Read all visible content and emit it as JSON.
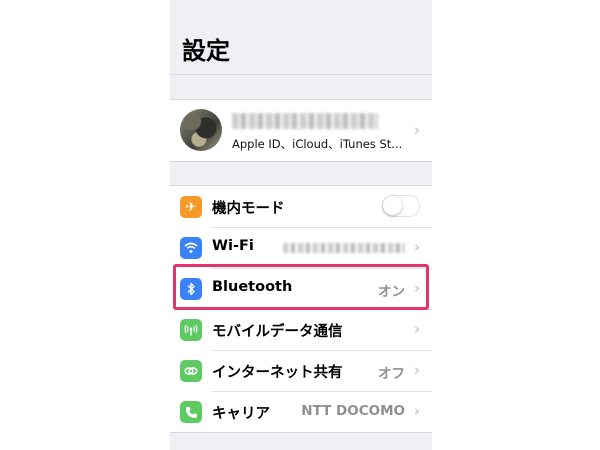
{
  "header": {
    "title": "設定"
  },
  "profile": {
    "subtitle": "Apple ID、iCloud、iTunes St...",
    "name_redacted": true
  },
  "settings": {
    "items": [
      {
        "id": "airplane",
        "label": "機内モード",
        "icon": "airplane-icon",
        "icon_color": "#f49a2b",
        "toggle": "off"
      },
      {
        "id": "wifi",
        "label": "Wi-Fi",
        "icon": "wifi-icon",
        "icon_color": "#3a82f7",
        "value_redacted": true
      },
      {
        "id": "bluetooth",
        "label": "Bluetooth",
        "icon": "bluetooth-icon",
        "icon_color": "#3a82f7",
        "value": "オン",
        "highlighted": true
      },
      {
        "id": "cellular",
        "label": "モバイルデータ通信",
        "icon": "antenna-icon",
        "icon_color": "#5ecb62"
      },
      {
        "id": "hotspot",
        "label": "インターネット共有",
        "icon": "hotspot-icon",
        "icon_color": "#5ecb62",
        "value": "オフ"
      },
      {
        "id": "carrier",
        "label": "キャリア",
        "icon": "phone-icon",
        "icon_color": "#5ecb62",
        "value": "NTT DOCOMO"
      }
    ]
  },
  "colors": {
    "background": "#efeff4",
    "highlight_border": "#e8336a",
    "chevron": "#c7c7cc",
    "secondary_text": "#8e8e93"
  }
}
